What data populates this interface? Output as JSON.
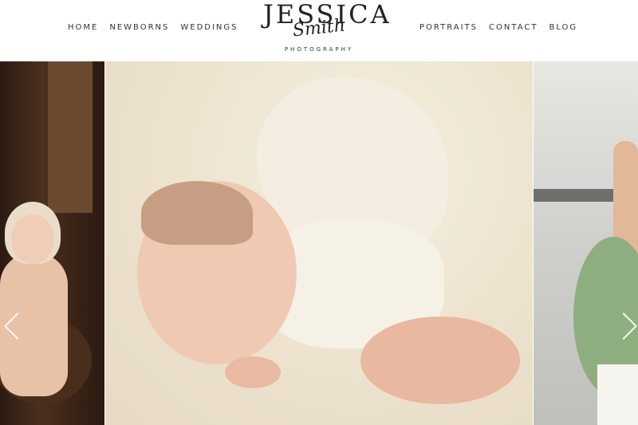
{
  "nav": {
    "left_items": [
      "HOME",
      "NEWBORNS",
      "WEDDINGS"
    ],
    "right_items": [
      "PORTRAITS",
      "CONTACT",
      "BLOG"
    ]
  },
  "logo": {
    "main": "JESSICA",
    "script": "Smith",
    "sub": "PHOTOGRAPHY"
  },
  "gallery": {
    "slides": [
      {
        "subject": "baby-in-lace-bonnet"
      },
      {
        "subject": "sleeping-newborn"
      },
      {
        "subject": "bride-with-bouquet"
      }
    ]
  },
  "colors": {
    "text": "#333333",
    "logo": "#222222",
    "background": "#ffffff"
  }
}
